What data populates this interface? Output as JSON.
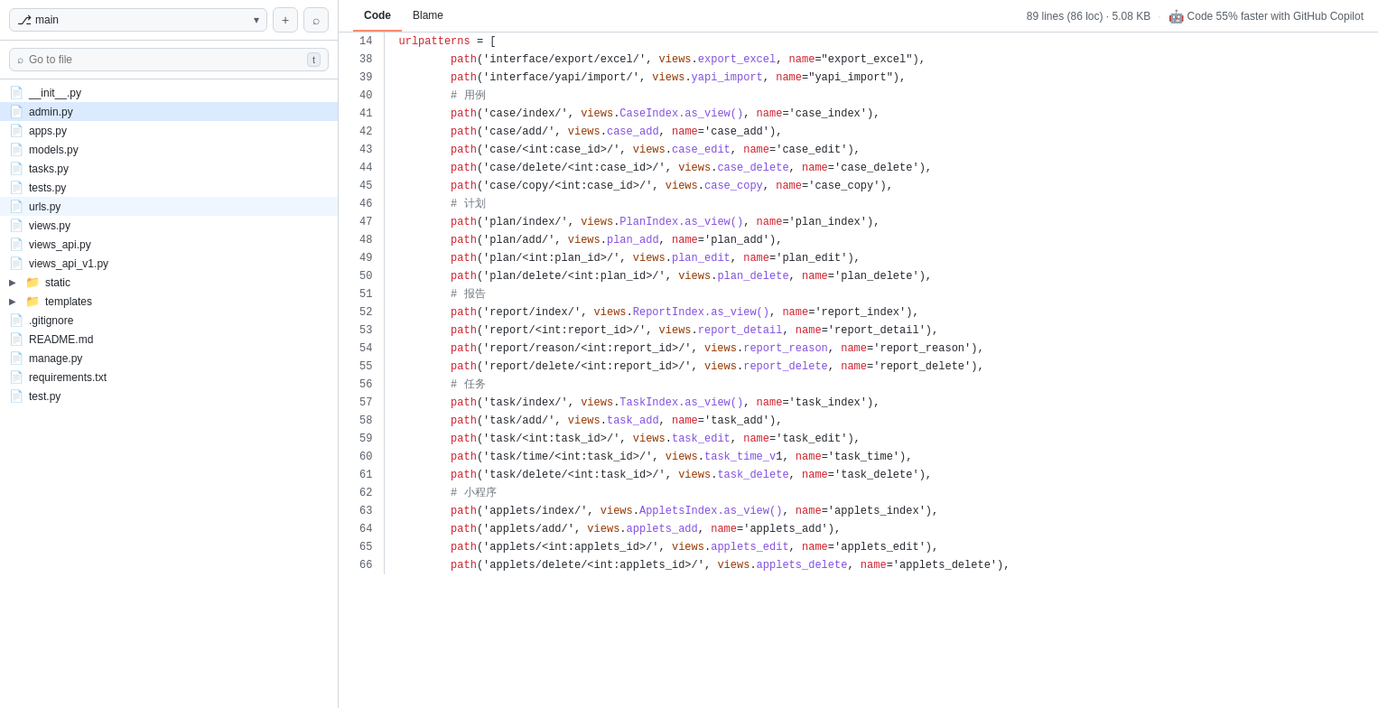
{
  "sidebar": {
    "branch": "main",
    "search_placeholder": "Go to file",
    "search_shortcut": "t",
    "files": [
      {
        "id": "init",
        "type": "file",
        "label": "__init__.py",
        "icon": "📄",
        "active": false
      },
      {
        "id": "admin",
        "type": "file",
        "label": "admin.py",
        "icon": "📄",
        "active": true
      },
      {
        "id": "apps",
        "type": "file",
        "label": "apps.py",
        "icon": "📄",
        "active": false
      },
      {
        "id": "models",
        "type": "file",
        "label": "models.py",
        "icon": "📄",
        "active": false
      },
      {
        "id": "tasks",
        "type": "file",
        "label": "tasks.py",
        "icon": "📄",
        "active": false
      },
      {
        "id": "tests",
        "type": "file",
        "label": "tests.py",
        "icon": "📄",
        "active": false
      },
      {
        "id": "urls",
        "type": "file",
        "label": "urls.py",
        "icon": "📄",
        "active": false,
        "highlight": true
      },
      {
        "id": "views",
        "type": "file",
        "label": "views.py",
        "icon": "📄",
        "active": false
      },
      {
        "id": "views_api",
        "type": "file",
        "label": "views_api.py",
        "icon": "📄",
        "active": false
      },
      {
        "id": "views_api_v1",
        "type": "file",
        "label": "views_api_v1.py",
        "icon": "📄",
        "active": false
      },
      {
        "id": "static",
        "type": "folder",
        "label": "static",
        "icon": "📁",
        "active": false,
        "collapsed": true
      },
      {
        "id": "templates",
        "type": "folder",
        "label": "templates",
        "icon": "📁",
        "active": false,
        "collapsed": true
      },
      {
        "id": "gitignore",
        "type": "file",
        "label": ".gitignore",
        "icon": "📄",
        "active": false
      },
      {
        "id": "readme",
        "type": "file",
        "label": "README.md",
        "icon": "📄",
        "active": false
      },
      {
        "id": "manage",
        "type": "file",
        "label": "manage.py",
        "icon": "📄",
        "active": false
      },
      {
        "id": "requirements",
        "type": "file",
        "label": "requirements.txt",
        "icon": "📄",
        "active": false
      },
      {
        "id": "test",
        "type": "file",
        "label": "test.py",
        "icon": "📄",
        "active": false
      }
    ]
  },
  "code_header": {
    "tab_code": "Code",
    "tab_blame": "Blame",
    "file_info": "89 lines (86 loc) · 5.08 KB",
    "copilot_text": "Code 55% faster with GitHub Copilot"
  },
  "code_lines": [
    {
      "num": 14,
      "content": "urlpatterns = ["
    },
    {
      "num": 38,
      "content": "        path('interface/export/excel/', views.export_excel, name=\"export_excel\"),"
    },
    {
      "num": 39,
      "content": "        path('interface/yapi/import/', views.yapi_import, name=\"yapi_import\"),"
    },
    {
      "num": 40,
      "content": "        # 用例"
    },
    {
      "num": 41,
      "content": "        path('case/index/', views.CaseIndex.as_view(), name='case_index'),"
    },
    {
      "num": 42,
      "content": "        path('case/add/', views.case_add, name='case_add'),"
    },
    {
      "num": 43,
      "content": "        path('case/<int:case_id>/', views.case_edit, name='case_edit'),"
    },
    {
      "num": 44,
      "content": "        path('case/delete/<int:case_id>/', views.case_delete, name='case_delete'),"
    },
    {
      "num": 45,
      "content": "        path('case/copy/<int:case_id>/', views.case_copy, name='case_copy'),"
    },
    {
      "num": 46,
      "content": "        # 计划"
    },
    {
      "num": 47,
      "content": "        path('plan/index/', views.PlanIndex.as_view(), name='plan_index'),"
    },
    {
      "num": 48,
      "content": "        path('plan/add/', views.plan_add, name='plan_add'),"
    },
    {
      "num": 49,
      "content": "        path('plan/<int:plan_id>/', views.plan_edit, name='plan_edit'),"
    },
    {
      "num": 50,
      "content": "        path('plan/delete/<int:plan_id>/', views.plan_delete, name='plan_delete'),"
    },
    {
      "num": 51,
      "content": "        # 报告"
    },
    {
      "num": 52,
      "content": "        path('report/index/', views.ReportIndex.as_view(), name='report_index'),"
    },
    {
      "num": 53,
      "content": "        path('report/<int:report_id>/', views.report_detail, name='report_detail'),"
    },
    {
      "num": 54,
      "content": "        path('report/reason/<int:report_id>/', views.report_reason, name='report_reason'),"
    },
    {
      "num": 55,
      "content": "        path('report/delete/<int:report_id>/', views.report_delete, name='report_delete'),"
    },
    {
      "num": 56,
      "content": "        # 任务"
    },
    {
      "num": 57,
      "content": "        path('task/index/', views.TaskIndex.as_view(), name='task_index'),"
    },
    {
      "num": 58,
      "content": "        path('task/add/', views.task_add, name='task_add'),"
    },
    {
      "num": 59,
      "content": "        path('task/<int:task_id>/', views.task_edit, name='task_edit'),"
    },
    {
      "num": 60,
      "content": "        path('task/time/<int:task_id>/', views.task_time_v1, name='task_time'),"
    },
    {
      "num": 61,
      "content": "        path('task/delete/<int:task_id>/', views.task_delete, name='task_delete'),"
    },
    {
      "num": 62,
      "content": "        # 小程序"
    },
    {
      "num": 63,
      "content": "        path('applets/index/', views.AppletsIndex.as_view(), name='applets_index'),"
    },
    {
      "num": 64,
      "content": "        path('applets/add/', views.applets_add, name='applets_add'),"
    },
    {
      "num": 65,
      "content": "        path('applets/<int:applets_id>/', views.applets_edit, name='applets_edit'),"
    },
    {
      "num": 66,
      "content": "        path('applets/delete/<int:applets_id>/', views.applets_delete, name='applets_delete'),"
    }
  ]
}
